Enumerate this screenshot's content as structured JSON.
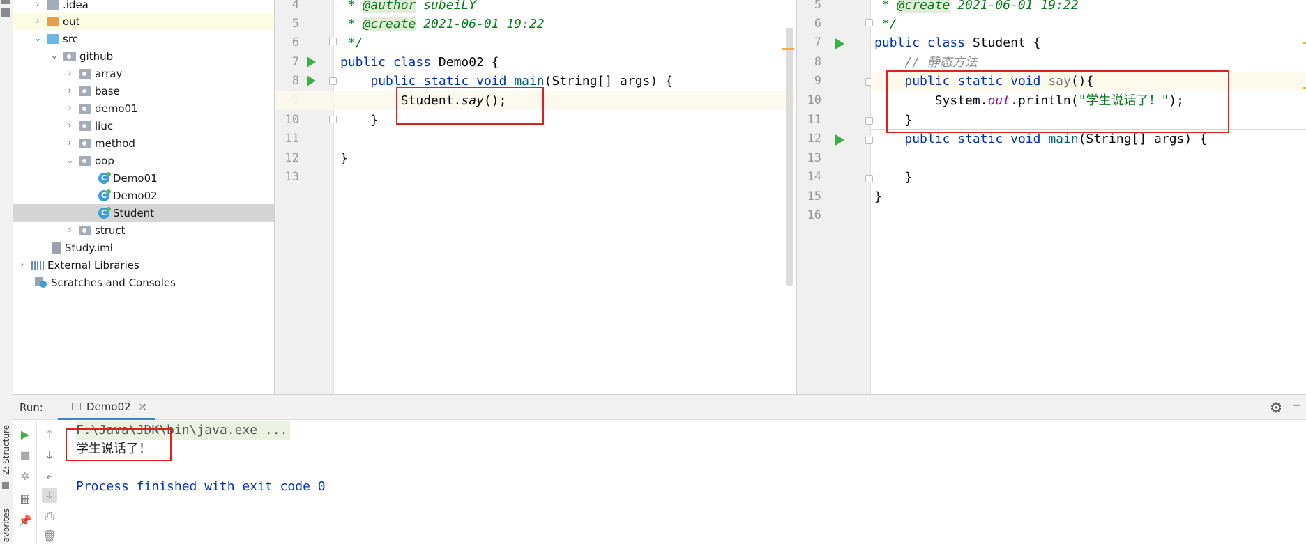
{
  "sidebar_tools": {
    "structure_label": "Z: Structure",
    "favorites_label": "avorites"
  },
  "project_tree": {
    "items": [
      {
        "label": ".idea",
        "icon": "folder-icon"
      },
      {
        "label": "out",
        "icon": "folder-orange-icon"
      },
      {
        "label": "src",
        "icon": "source-folder-icon"
      },
      {
        "label": "github",
        "icon": "package-icon"
      },
      {
        "label": "array",
        "icon": "package-icon"
      },
      {
        "label": "base",
        "icon": "package-icon"
      },
      {
        "label": "demo01",
        "icon": "package-icon"
      },
      {
        "label": "liuc",
        "icon": "package-icon"
      },
      {
        "label": "method",
        "icon": "package-icon"
      },
      {
        "label": "oop",
        "icon": "package-icon"
      },
      {
        "label": "Demo01",
        "icon": "java-class-icon"
      },
      {
        "label": "Demo02",
        "icon": "java-class-icon"
      },
      {
        "label": "Student",
        "icon": "java-class-icon"
      },
      {
        "label": "struct",
        "icon": "package-icon"
      },
      {
        "label": "Study.iml",
        "icon": "iml-file-icon"
      },
      {
        "label": "External Libraries",
        "icon": "library-icon"
      },
      {
        "label": "Scratches and Consoles",
        "icon": "scratches-icon"
      }
    ],
    "class_glyph": "C"
  },
  "editor_left": {
    "file": "Demo02",
    "line_numbers": [
      "4",
      "5",
      "6",
      "7",
      "8",
      "9",
      "10",
      "11",
      "12",
      "13"
    ],
    "lines": {
      "l4": {
        "star": " * ",
        "tag": "@author",
        "rest": " subeiLY"
      },
      "l5": {
        "star": " * ",
        "tag": "@create",
        "rest": " 2021-06-01 19:22"
      },
      "l6": {
        "text": " */"
      },
      "l7": {
        "kw1": "public",
        "kw2": "class",
        "name": " Demo02 {"
      },
      "l8": {
        "indent": "    ",
        "kw1": "public",
        "kw2": "static",
        "kw3": "void",
        "meth": "main",
        "rest": "(String[] args) {"
      },
      "l9": {
        "indent": "        ",
        "cls": "Student.",
        "meth": "say",
        "rest": "();"
      },
      "l10": {
        "text": "    }"
      },
      "l11": {
        "text": ""
      },
      "l12": {
        "text": "}"
      },
      "l13": {
        "text": ""
      }
    }
  },
  "editor_right": {
    "file": "Student",
    "line_numbers": [
      "5",
      "6",
      "7",
      "8",
      "9",
      "10",
      "11",
      "12",
      "13",
      "14",
      "15",
      "16"
    ],
    "lines": {
      "l5": {
        "star": " * ",
        "tag": "@create",
        "rest": " 2021-06-01 19:22"
      },
      "l6": {
        "text": " */"
      },
      "l7": {
        "kw1": "public",
        "kw2": "class",
        "name": " Student {"
      },
      "l8": {
        "indent": "    ",
        "comment": "// 静态方法"
      },
      "l9": {
        "indent": "    ",
        "kw1": "public",
        "kw2": "static",
        "kw3": "void",
        "meth": "say",
        "rest": "(){"
      },
      "l10": {
        "indent": "        ",
        "cls": "System.",
        "field": "out",
        "mid": ".println(",
        "str": "\"学生说话了！\"",
        "rest": ");"
      },
      "l11": {
        "text": "    }"
      },
      "l12": {
        "indent": "    ",
        "kw1": "public",
        "kw2": "static",
        "kw3": "void",
        "meth": "main",
        "rest": "(String[] args) {"
      },
      "l13": {
        "text": ""
      },
      "l14": {
        "text": "    }"
      },
      "l15": {
        "text": "}"
      },
      "l16": {
        "text": ""
      }
    }
  },
  "run_panel": {
    "label": "Run:",
    "tab_label": "Demo02",
    "tab_close": "×",
    "tab_more": ":",
    "console": {
      "command": "F:\\Java\\JDK\\bin\\java.exe ...",
      "output": "学生说话了！",
      "exit_message": "Process finished with exit code 0"
    }
  },
  "colors": {
    "keyword": "#0033b3",
    "doc_comment": "#067d17",
    "string": "#067d17",
    "method": "#00627a",
    "field": "#871094",
    "run_green": "#3fae49",
    "highlight_box": "#e0201b",
    "console_exit": "#0033b3"
  }
}
